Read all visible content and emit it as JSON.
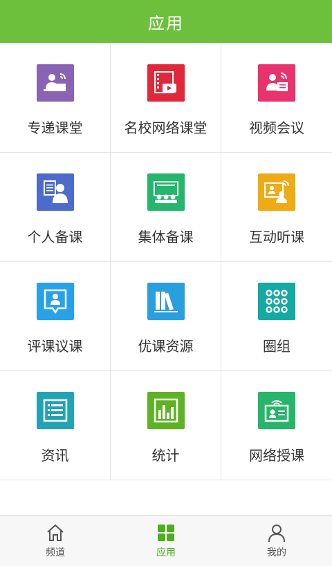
{
  "header": {
    "title": "应用"
  },
  "apps": [
    {
      "label": "专递课堂",
      "icon": "teacher-broadcast-icon",
      "color": "#8a63b4"
    },
    {
      "label": "名校网络课堂",
      "icon": "video-film-icon",
      "color": "#e0283a"
    },
    {
      "label": "视频会议",
      "icon": "video-conference-icon",
      "color": "#e8336e"
    },
    {
      "label": "个人备课",
      "icon": "personal-lesson-icon",
      "color": "#4c6bcb"
    },
    {
      "label": "集体备课",
      "icon": "group-lesson-icon",
      "color": "#23b66c"
    },
    {
      "label": "互动听课",
      "icon": "interactive-class-icon",
      "color": "#efab16"
    },
    {
      "label": "评课议课",
      "icon": "lesson-review-icon",
      "color": "#27a2e8"
    },
    {
      "label": "优课资源",
      "icon": "book-resources-icon",
      "color": "#2a9fde"
    },
    {
      "label": "圈组",
      "icon": "circle-group-icon",
      "color": "#14a9a2"
    },
    {
      "label": "资讯",
      "icon": "news-list-icon",
      "color": "#21a3b5"
    },
    {
      "label": "统计",
      "icon": "statistics-chart-icon",
      "color": "#5eb223"
    },
    {
      "label": "网络授课",
      "icon": "online-teaching-icon",
      "color": "#26b56a"
    }
  ],
  "tabbar": {
    "items": [
      {
        "label": "频道",
        "icon": "home-icon",
        "active": false
      },
      {
        "label": "应用",
        "icon": "apps-grid-icon",
        "active": true
      },
      {
        "label": "我的",
        "icon": "person-icon",
        "active": false
      }
    ],
    "active_color": "#4caf1e",
    "inactive_color": "#555555"
  }
}
